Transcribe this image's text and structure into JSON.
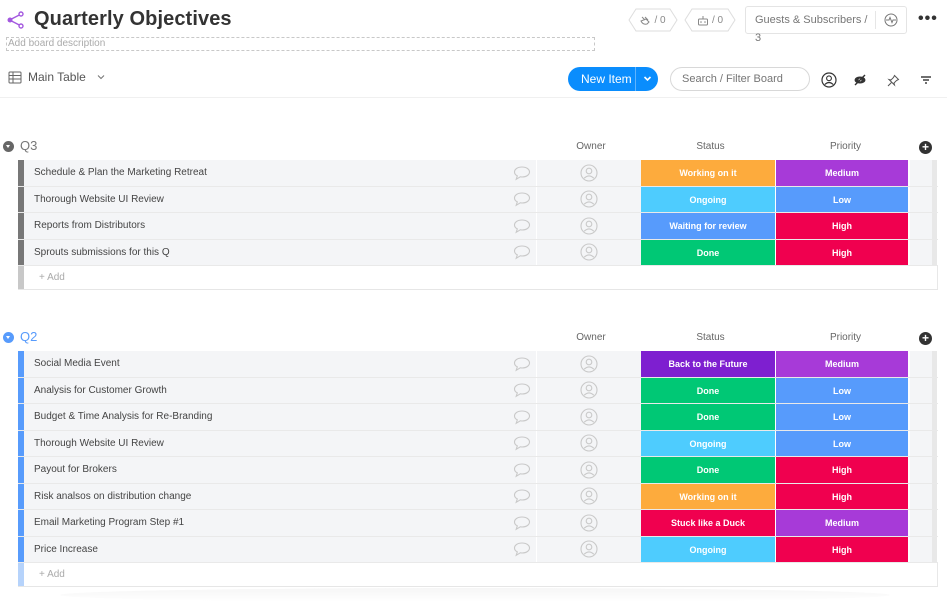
{
  "header": {
    "title": "Quarterly Objectives",
    "description_placeholder": "Add board description",
    "integrations": {
      "icon": "plug-icon",
      "count": "/ 0"
    },
    "automations": {
      "icon": "robot-icon",
      "count": "/ 0"
    },
    "guests_label": "Guests & Subscribers / 3",
    "activity_icon": "activity-icon",
    "more_label": "•••"
  },
  "toolbar": {
    "view_label": "Main Table",
    "new_item_label": "New Item",
    "search_placeholder": "Search / Filter Board"
  },
  "columns": {
    "owner": "Owner",
    "status": "Status",
    "priority": "Priority"
  },
  "colors": {
    "accent_blue": "#0a8dfd",
    "working": "#fdab3d",
    "ongoing": "#4eccfe",
    "waiting": "#579bfc",
    "done": "#00c875",
    "back_to_future": "#7e1fd0",
    "stuck": "#f0004f",
    "medium": "#a73ad8",
    "low": "#579bfc",
    "high": "#f0004f",
    "q3_group": "#777777",
    "q2_group": "#579bfc"
  },
  "groups": [
    {
      "title": "Q3",
      "color": "#777777",
      "add_label": "+ Add",
      "items": [
        {
          "name": "Schedule & Plan the Marketing Retreat",
          "status": "Working on it",
          "status_color": "#fdab3d",
          "priority": "Medium",
          "priority_color": "#a73ad8"
        },
        {
          "name": "Thorough Website UI Review",
          "status": "Ongoing",
          "status_color": "#4eccfe",
          "priority": "Low",
          "priority_color": "#579bfc"
        },
        {
          "name": "Reports from Distributors",
          "status": "Waiting for review",
          "status_color": "#579bfc",
          "priority": "High",
          "priority_color": "#f0004f"
        },
        {
          "name": "Sprouts submissions for this Q",
          "status": "Done",
          "status_color": "#00c875",
          "priority": "High",
          "priority_color": "#f0004f"
        }
      ]
    },
    {
      "title": "Q2",
      "color": "#579bfc",
      "add_label": "+ Add",
      "items": [
        {
          "name": "Social Media Event",
          "status": "Back to the Future",
          "status_color": "#7e1fd0",
          "priority": "Medium",
          "priority_color": "#a73ad8"
        },
        {
          "name": "Analysis for Customer Growth",
          "status": "Done",
          "status_color": "#00c875",
          "priority": "Low",
          "priority_color": "#579bfc"
        },
        {
          "name": "Budget & Time Analysis for Re-Branding",
          "status": "Done",
          "status_color": "#00c875",
          "priority": "Low",
          "priority_color": "#579bfc"
        },
        {
          "name": "Thorough Website UI Review",
          "status": "Ongoing",
          "status_color": "#4eccfe",
          "priority": "Low",
          "priority_color": "#579bfc"
        },
        {
          "name": "Payout for Brokers",
          "status": "Done",
          "status_color": "#00c875",
          "priority": "High",
          "priority_color": "#f0004f"
        },
        {
          "name": "Risk analsos on distribution change",
          "status": "Working on it",
          "status_color": "#fdab3d",
          "priority": "High",
          "priority_color": "#f0004f"
        },
        {
          "name": "Email Marketing Program Step #1",
          "status": "Stuck like a Duck",
          "status_color": "#f0004f",
          "priority": "Medium",
          "priority_color": "#a73ad8"
        },
        {
          "name": "Price Increase",
          "status": "Ongoing",
          "status_color": "#4eccfe",
          "priority": "High",
          "priority_color": "#f0004f"
        }
      ]
    }
  ]
}
